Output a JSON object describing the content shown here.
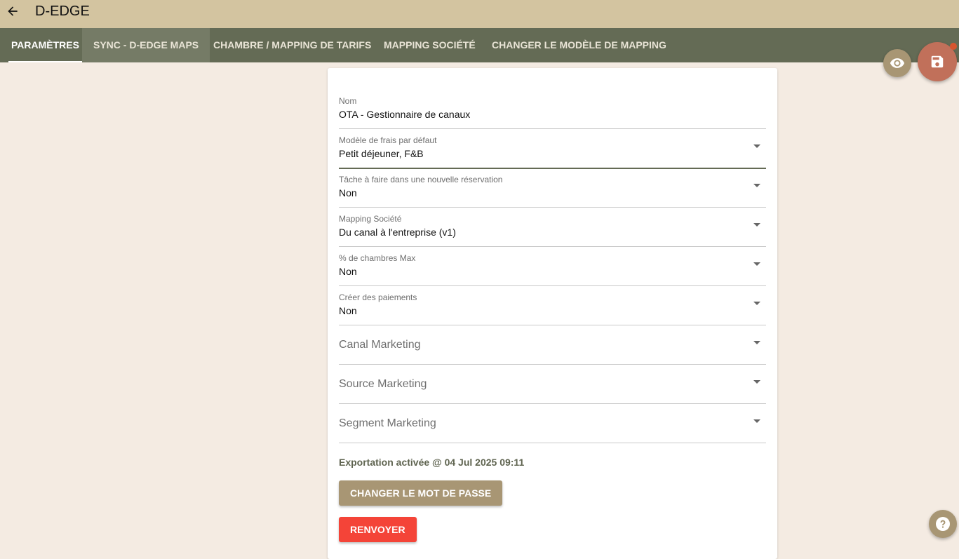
{
  "header": {
    "title": "D-EDGE"
  },
  "tabs": [
    {
      "label": "PARAMÈTRES"
    },
    {
      "label": "SYNC - D-EDGE MAPS"
    },
    {
      "label": "CHAMBRE / MAPPING DE TARIFS"
    },
    {
      "label": "MAPPING SOCIÉTÉ"
    },
    {
      "label": "CHANGER LE MODÈLE DE MAPPING"
    }
  ],
  "form": {
    "name": {
      "label": "Nom",
      "value": "OTA - Gestionnaire de canaux"
    },
    "fee_model": {
      "label": "Modèle de frais par défaut",
      "value": "Petit déjeuner, F&B"
    },
    "task": {
      "label": "Tâche à faire dans une nouvelle réservation",
      "value": "Non"
    },
    "company_mapping": {
      "label": "Mapping Société",
      "value": "Du canal à l'entreprise (v1)"
    },
    "max_rooms": {
      "label": "% de chambres Max",
      "value": "Non"
    },
    "payments": {
      "label": "Créer des paiements",
      "value": "Non"
    },
    "marketing_channel": {
      "placeholder": "Canal Marketing"
    },
    "marketing_source": {
      "placeholder": "Source Marketing"
    },
    "marketing_segment": {
      "placeholder": "Segment Marketing"
    }
  },
  "export_status": "Exportation activée @ 04 Jul 2025 09:11",
  "buttons": {
    "change_password": "CHANGER LE MOT DE PASSE",
    "resend": "RENVOYER"
  },
  "icons": {
    "back": "arrow-left-icon",
    "eye": "eye-icon",
    "save": "floppy-disk-icon",
    "help": "question-mark-icon"
  },
  "colors": {
    "topbar": "#d3c4a0",
    "tabbar": "#646b55",
    "accent": "#a89674",
    "save": "#c1705a",
    "danger": "#f44438"
  }
}
